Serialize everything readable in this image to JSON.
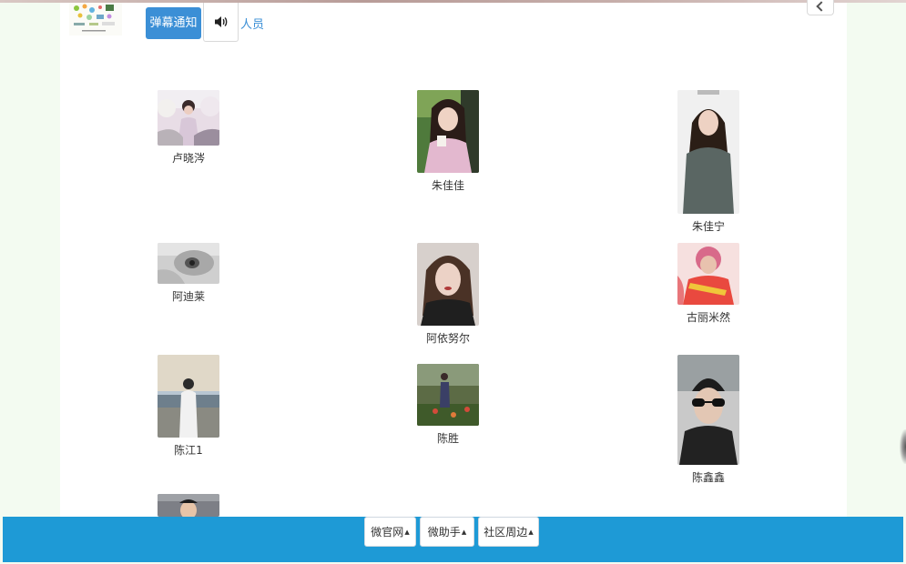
{
  "header": {
    "notice_button": "弹幕通知",
    "sound_icon": "speaker-icon",
    "people_link": "人员"
  },
  "people": [
    {
      "name": "卢晓涔"
    },
    {
      "name": "朱佳佳"
    },
    {
      "name": "朱佳宁"
    },
    {
      "name": "阿迪莱"
    },
    {
      "name": "阿依努尔"
    },
    {
      "name": "古丽米然"
    },
    {
      "name": "陈江1"
    },
    {
      "name": "陈胜"
    },
    {
      "name": "陈鑫鑫"
    },
    {
      "name": ""
    }
  ],
  "footer": {
    "items": [
      {
        "label": "微官网"
      },
      {
        "label": "微助手"
      },
      {
        "label": "社区周边"
      }
    ],
    "caret": "▲"
  },
  "colors": {
    "primary": "#3b8fd6",
    "footer": "#1e9ad6",
    "page_bg": "#f3fbf1"
  }
}
